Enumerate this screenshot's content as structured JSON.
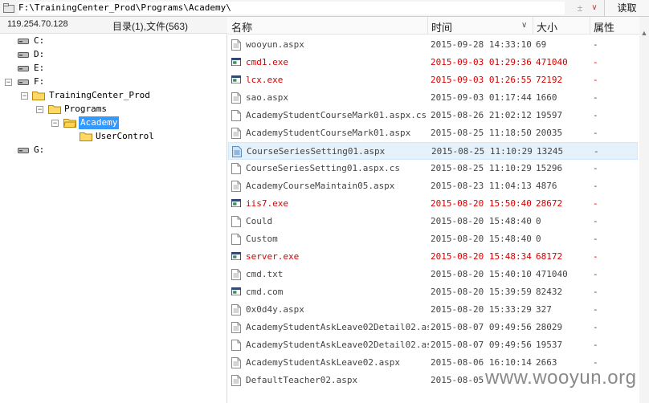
{
  "address": {
    "path": "F:\\TrainingCenter_Prod\\Programs\\Academy\\",
    "star": "±",
    "dropdown": "∨",
    "read_button": "读取"
  },
  "left": {
    "ip": "119.254.70.128",
    "dir_count": "目录(1),文件(563)",
    "tree": {
      "drives": [
        "C:",
        "D:",
        "E:",
        "F:",
        "G:"
      ],
      "training": "TrainingCenter_Prod",
      "programs": "Programs",
      "academy": "Academy",
      "usercontrol": "UserControl",
      "minus": "−",
      "plus": "+"
    }
  },
  "columns": {
    "name": "名称",
    "time": "时间",
    "size": "大小",
    "attr": "属性"
  },
  "files": [
    {
      "name": "wooyun.aspx",
      "time": "2015-09-28 14:33:10",
      "size": "69",
      "attr": "-",
      "kind": "doc"
    },
    {
      "name": "cmd1.exe",
      "time": "2015-09-03 01:29:36",
      "size": "471040",
      "attr": "-",
      "kind": "exe"
    },
    {
      "name": "lcx.exe",
      "time": "2015-09-03 01:26:55",
      "size": "72192",
      "attr": "-",
      "kind": "exe"
    },
    {
      "name": "sao.aspx",
      "time": "2015-09-03 01:17:44",
      "size": "1660",
      "attr": "-",
      "kind": "doc"
    },
    {
      "name": "AcademyStudentCourseMark01.aspx.cs",
      "time": "2015-08-26 21:02:12",
      "size": "19597",
      "attr": "-",
      "kind": "blank"
    },
    {
      "name": "AcademyStudentCourseMark01.aspx",
      "time": "2015-08-25 11:18:50",
      "size": "20035",
      "attr": "-",
      "kind": "doc"
    },
    {
      "name": "CourseSeriesSetting01.aspx",
      "time": "2015-08-25 11:10:29",
      "size": "13245",
      "attr": "-",
      "kind": "doc-sel"
    },
    {
      "name": "CourseSeriesSetting01.aspx.cs",
      "time": "2015-08-25 11:10:29",
      "size": "15296",
      "attr": "-",
      "kind": "blank"
    },
    {
      "name": "AcademyCourseMaintain05.aspx",
      "time": "2015-08-23 11:04:13",
      "size": "4876",
      "attr": "-",
      "kind": "doc"
    },
    {
      "name": "iis7.exe",
      "time": "2015-08-20 15:50:40",
      "size": "28672",
      "attr": "-",
      "kind": "exe"
    },
    {
      "name": "Could",
      "time": "2015-08-20 15:48:40",
      "size": "0",
      "attr": "-",
      "kind": "blank"
    },
    {
      "name": "Custom",
      "time": "2015-08-20 15:48:40",
      "size": "0",
      "attr": "-",
      "kind": "blank"
    },
    {
      "name": "server.exe",
      "time": "2015-08-20 15:48:34",
      "size": "68172",
      "attr": "-",
      "kind": "exe"
    },
    {
      "name": "cmd.txt",
      "time": "2015-08-20 15:40:10",
      "size": "471040",
      "attr": "-",
      "kind": "doc"
    },
    {
      "name": "cmd.com",
      "time": "2015-08-20 15:39:59",
      "size": "82432",
      "attr": "-",
      "kind": "app"
    },
    {
      "name": "0x0d4y.aspx",
      "time": "2015-08-20 15:33:29",
      "size": "327",
      "attr": "-",
      "kind": "doc"
    },
    {
      "name": "AcademyStudentAskLeave02Detail02.aspx",
      "time": "2015-08-07 09:49:56",
      "size": "28029",
      "attr": "-",
      "kind": "doc"
    },
    {
      "name": "AcademyStudentAskLeave02Detail02.as...",
      "time": "2015-08-07 09:49:56",
      "size": "19537",
      "attr": "-",
      "kind": "blank"
    },
    {
      "name": "AcademyStudentAskLeave02.aspx",
      "time": "2015-08-06 16:10:14",
      "size": "2663",
      "attr": "-",
      "kind": "doc"
    },
    {
      "name": "DefaultTeacher02.aspx",
      "time": "2015-08-05",
      "size": "",
      "attr": "-",
      "kind": "doc"
    }
  ],
  "watermark": "www.wooyun.org",
  "colors": {
    "exe_red": "#d40000",
    "selection": "#3399ff",
    "row_highlight": "#e5f1fb"
  }
}
